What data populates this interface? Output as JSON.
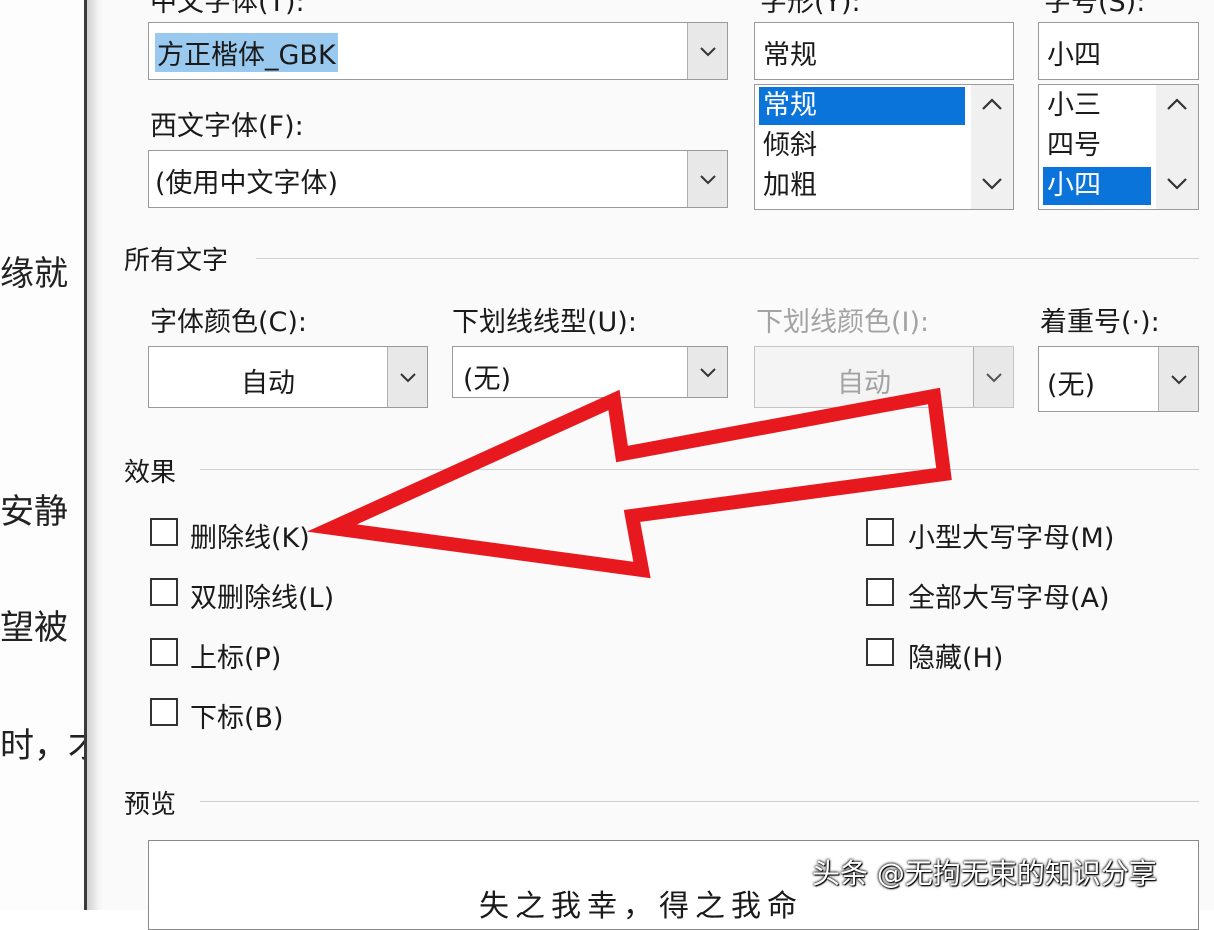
{
  "doc_text": [
    "缘就",
    "安静",
    "望被",
    "时，才"
  ],
  "font": {
    "chinese_label": "中文字体(T):",
    "chinese_value": "方正楷体_GBK",
    "western_label": "西文字体(F):",
    "western_value": "(使用中文字体)",
    "style_label": "字形(Y):",
    "style_value": "常规",
    "style_options": [
      "常规",
      "倾斜",
      "加粗"
    ],
    "size_label": "字号(S):",
    "size_value": "小四",
    "size_options": [
      "小三",
      "四号",
      "小四"
    ]
  },
  "all_text": {
    "section_label": "所有文字",
    "color_label": "字体颜色(C):",
    "color_value": "自动",
    "underline_label": "下划线线型(U):",
    "underline_value": "(无)",
    "underline_color_label": "下划线颜色(I):",
    "underline_color_value": "自动",
    "emphasis_label": "着重号(·):",
    "emphasis_value": "(无)"
  },
  "effects": {
    "section_label": "效果",
    "left": [
      "删除线(K)",
      "双删除线(L)",
      "上标(P)",
      "下标(B)"
    ],
    "right": [
      "小型大写字母(M)",
      "全部大写字母(A)",
      "隐藏(H)"
    ]
  },
  "preview": {
    "section_label": "预览",
    "sample_text": "失之我幸，得之我命"
  },
  "watermark": "头条 @无拘无束的知识分享",
  "colors": {
    "accent": "#0a74da",
    "arrow": "#e8191e"
  }
}
